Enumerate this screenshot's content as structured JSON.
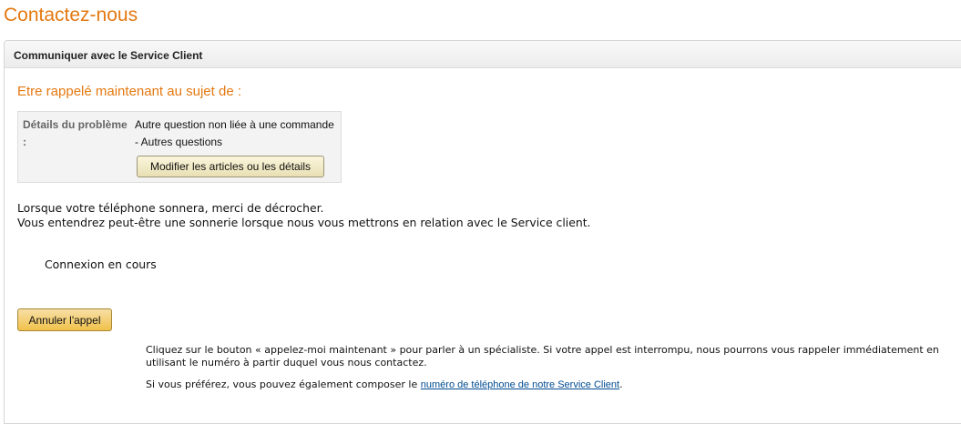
{
  "page": {
    "title": "Contactez-nous"
  },
  "box": {
    "header_title": "Communiquer avec le Service Client",
    "section_title": "Etre rappelé maintenant au sujet de :"
  },
  "details": {
    "label": "Détails du problème :",
    "value_line1": "Autre question non liée à une commande",
    "value_line2": "- Autres questions",
    "modify_button_label": "Modifier les articles ou les détails"
  },
  "instructions": {
    "line1": "Lorsque votre téléphone sonnera, merci de décrocher.",
    "line2": "Vous entendrez peut-être une sonnerie lorsque nous vous mettrons en relation avec le Service client."
  },
  "status": {
    "text": "Connexion en cours"
  },
  "cancel_button_label": "Annuler l'appel",
  "info": {
    "paragraph1": "Cliquez sur le bouton « appelez-moi maintenant » pour parler à un spécialiste. Si votre appel est interrompu, nous pourrons vous rappeler immédiatement en utilisant le numéro à partir duquel vous nous contactez.",
    "paragraph2_prefix": "Si vous préférez, vous pouvez également composer le ",
    "paragraph2_link": "numéro de téléphone de notre Service Client",
    "paragraph2_suffix": "."
  },
  "colors": {
    "accent": "#e47911",
    "link": "#004b91",
    "primary_button": "#f0c14b"
  }
}
